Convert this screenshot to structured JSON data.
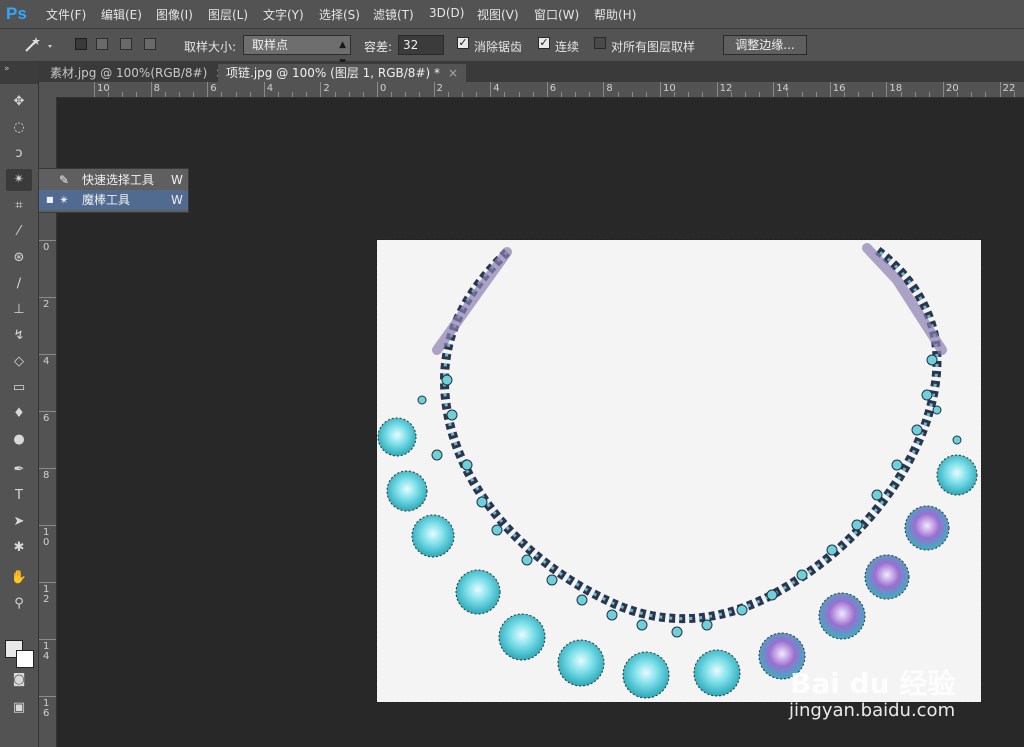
{
  "app": {
    "logo": "Ps",
    "menu": [
      "文件(F)",
      "编辑(E)",
      "图像(I)",
      "图层(L)",
      "文字(Y)",
      "选择(S)",
      "滤镜(T)",
      "3D(D)",
      "视图(V)",
      "窗口(W)",
      "帮助(H)"
    ]
  },
  "options": {
    "tool_icon": "magic-wand-icon",
    "sample_size_label": "取样大小:",
    "sample_size_value": "取样点",
    "tolerance_label": "容差:",
    "tolerance_value": "32",
    "antialias_label": "消除锯齿",
    "antialias_checked": true,
    "contiguous_label": "连续",
    "contiguous_checked": true,
    "sample_all_layers_label": "对所有图层取样",
    "sample_all_layers_checked": false,
    "refine_edge_label": "调整边缘..."
  },
  "tabs": [
    {
      "label": "素材.jpg @ 100%(RGB/8#)",
      "close": "×",
      "active": false
    },
    {
      "label": "项链.jpg @ 100% (图层 1, RGB/8#) *",
      "close": "×",
      "active": true
    }
  ],
  "ruler": {
    "h_labels": [
      "10",
      "8",
      "6",
      "4",
      "2",
      "0",
      "2",
      "4",
      "6",
      "8",
      "10",
      "12",
      "14",
      "16",
      "18",
      "20",
      "22"
    ],
    "v_labels": [
      "0",
      "2",
      "4",
      "6",
      "8",
      "1\n0",
      "1\n2",
      "1\n4",
      "1\n6"
    ]
  },
  "flyout": {
    "items": [
      {
        "label": "快速选择工具",
        "key": "W",
        "icon": "quick-selection-icon",
        "active": false
      },
      {
        "label": "魔棒工具",
        "key": "W",
        "icon": "magic-wand-icon",
        "active": true
      }
    ]
  },
  "watermark": {
    "brand": "Bai du 经验",
    "url": "jingyan.baidu.com"
  },
  "colors": {
    "ps_blue": "#31a8ff",
    "highlight": "#506a90",
    "gem_cyan": "#5fd3e0"
  }
}
